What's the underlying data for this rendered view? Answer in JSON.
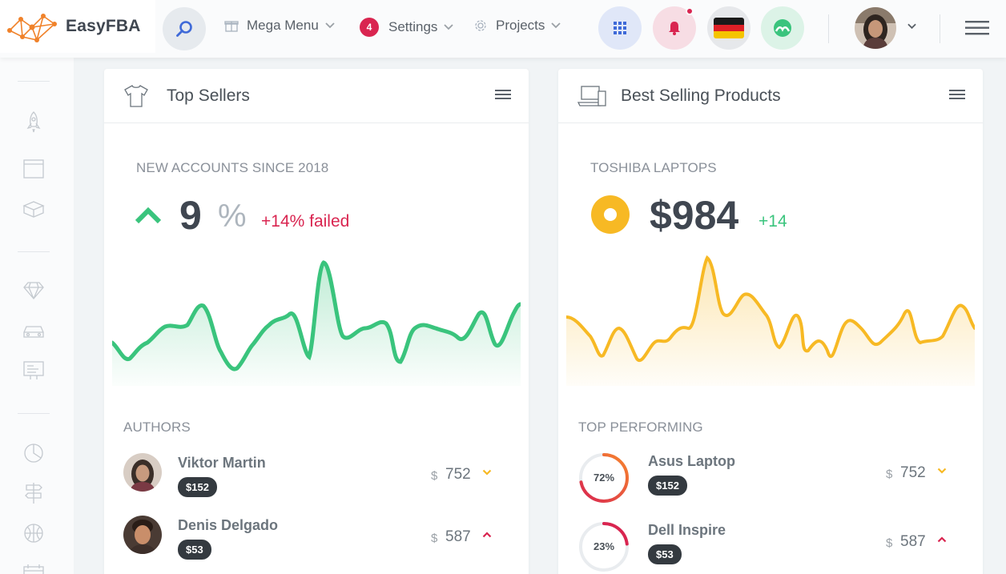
{
  "header": {
    "brand": "EasyFBA",
    "mega_menu": "Mega Menu",
    "settings": "Settings",
    "settings_badge": "4",
    "projects": "Projects"
  },
  "colors": {
    "accent_blue": "#3f6ad8",
    "success": "#3ac47d",
    "warning": "#f7b924",
    "danger": "#d92550"
  },
  "left_card": {
    "title": "Top Sellers",
    "metric_label": "NEW ACCOUNTS SINCE 2018",
    "metric_value": "9",
    "metric_unit": "%",
    "metric_change": "+14% failed",
    "section_label": "AUTHORS",
    "people": [
      {
        "name": "Viktor Martin",
        "pill": "$152",
        "currency": "$",
        "value": "752",
        "trend": "down"
      },
      {
        "name": "Denis Delgado",
        "pill": "$53",
        "currency": "$",
        "value": "587",
        "trend": "up"
      }
    ]
  },
  "right_card": {
    "title": "Best Selling Products",
    "metric_label": "TOSHIBA LAPTOPS",
    "metric_value": "$984",
    "metric_change": "+14",
    "section_label": "TOP PERFORMING",
    "products": [
      {
        "name": "Asus Laptop",
        "percent_label": "72%",
        "percent": 72,
        "pill": "$152",
        "currency": "$",
        "value": "752",
        "trend": "down"
      },
      {
        "name": "Dell Inspire",
        "percent_label": "23%",
        "percent": 23,
        "pill": "$53",
        "currency": "$",
        "value": "587",
        "trend": "up"
      }
    ]
  },
  "icons": [
    "search-icon",
    "grid-icon",
    "bell-icon",
    "germany-flag-icon",
    "status-icon",
    "menu-icon",
    "shirt-icon",
    "laptop-icon",
    "rocket-icon",
    "browser-icon",
    "box-icon",
    "diamond-icon",
    "car-icon",
    "presentation-icon",
    "pie-icon",
    "signpost-icon",
    "ball-icon"
  ]
}
